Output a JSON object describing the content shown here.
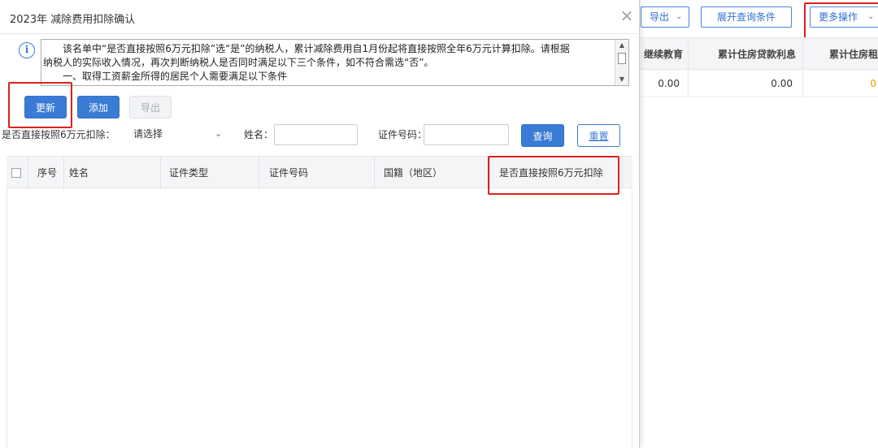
{
  "background": {
    "toolbar": {
      "export_label": "导出",
      "expand_query_label": "展开查询条件",
      "more_actions_label": "更多操作"
    },
    "table": {
      "columns": [
        "继续教育",
        "累计住房贷款利息",
        "累计住房租"
      ],
      "row": [
        "0.00",
        "0.00",
        "0"
      ]
    }
  },
  "dialog": {
    "title": "2023年 减除费用扣除确认",
    "notice": {
      "lines": [
        "　　该名单中“是否直接按照6万元扣除”选“是”的纳税人，累计减除费用自1月份起将直接按照全年6万元计算扣除。请根据",
        "纳税人的实际收入情况，再次判断纳税人是否同时满足以下三个条件，如不符合需选“否”。",
        "　　一、取得工资薪金所得的居民个人需要满足以下条件"
      ]
    },
    "actions": {
      "update_label": "更新",
      "add_label": "添加",
      "export_label": "导出"
    },
    "filters": {
      "deduct_label": "是否直接按照6万元扣除：",
      "deduct_value": "请选择",
      "name_label": "姓名：",
      "name_value": "",
      "id_label": "证件号码：",
      "id_value": "",
      "query_label": "查询",
      "reset_label": "重置"
    },
    "table": {
      "columns": [
        "序号",
        "姓名",
        "证件类型",
        "证件号码",
        "国籍（地区）",
        "是否直接按照6万元扣除"
      ],
      "rows": []
    }
  },
  "colors": {
    "primary": "#3a7bd5",
    "highlight": "#e0201b"
  }
}
